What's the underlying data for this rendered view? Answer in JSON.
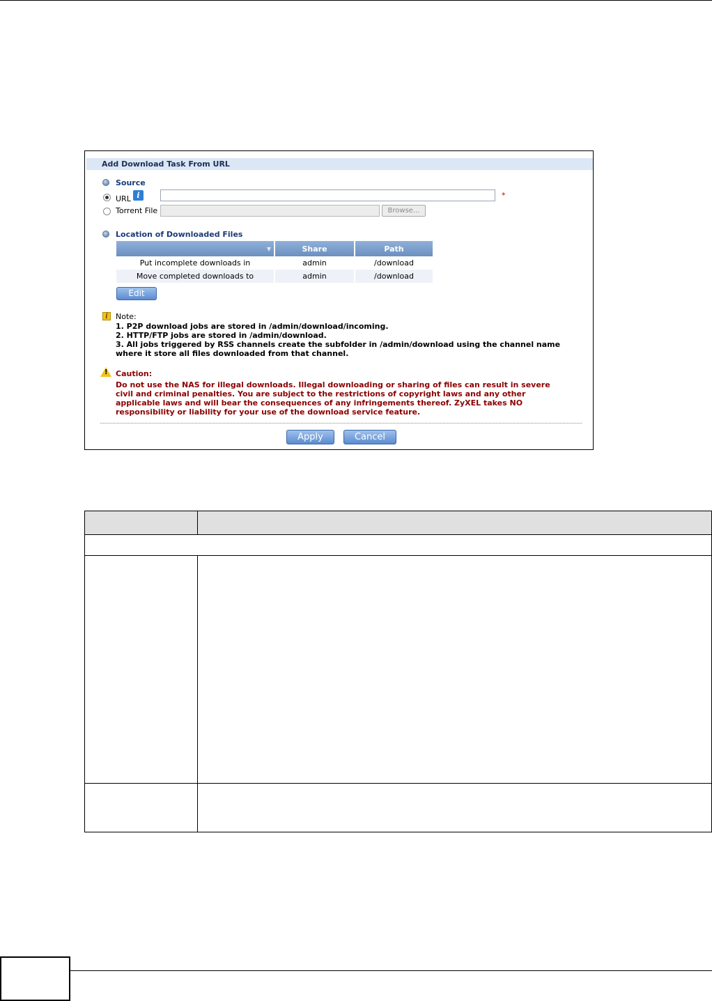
{
  "panel": {
    "title": "Add Download Task From URL",
    "source": {
      "section_title": "Source",
      "url_label": "URL",
      "url_value": "",
      "url_required_mark": "*",
      "torrent_label": "Torrent File",
      "torrent_value": "",
      "browse_label": "Browse..."
    },
    "location": {
      "section_title": "Location of Downloaded Files",
      "columns": [
        "",
        "Share",
        "Path"
      ],
      "rows": [
        {
          "label": "Put incomplete downloads in",
          "share": "admin",
          "path": "/download"
        },
        {
          "label": "Move completed downloads to",
          "share": "admin",
          "path": "/download"
        }
      ],
      "edit_label": "Edit"
    },
    "note": {
      "title": "Note:",
      "lines": [
        "1. P2P download jobs are stored in /admin/download/incoming.",
        "2. HTTP/FTP jobs are stored in /admin/download.",
        "3. All jobs triggered by RSS channels create the subfolder in /admin/download using the channel name",
        "where it store all files downloaded from that channel."
      ]
    },
    "caution": {
      "title": "Caution:",
      "lines": [
        "Do not use the NAS for illegal downloads. Illegal downloading or sharing of files can result in severe",
        "civil and criminal penalties. You are subject to the restrictions of copyright laws and any other",
        "applicable laws and will bear the consequences of any infringements thereof. ZyXEL takes NO",
        "responsibility or liability for your use of the download service feature."
      ]
    },
    "apply_label": "Apply",
    "cancel_label": "Cancel"
  },
  "colors": {
    "header_band": "#dbe7f5",
    "table_header": "#6b8fc0",
    "caution_text": "#8b0000",
    "section_title": "#1a3a78"
  }
}
